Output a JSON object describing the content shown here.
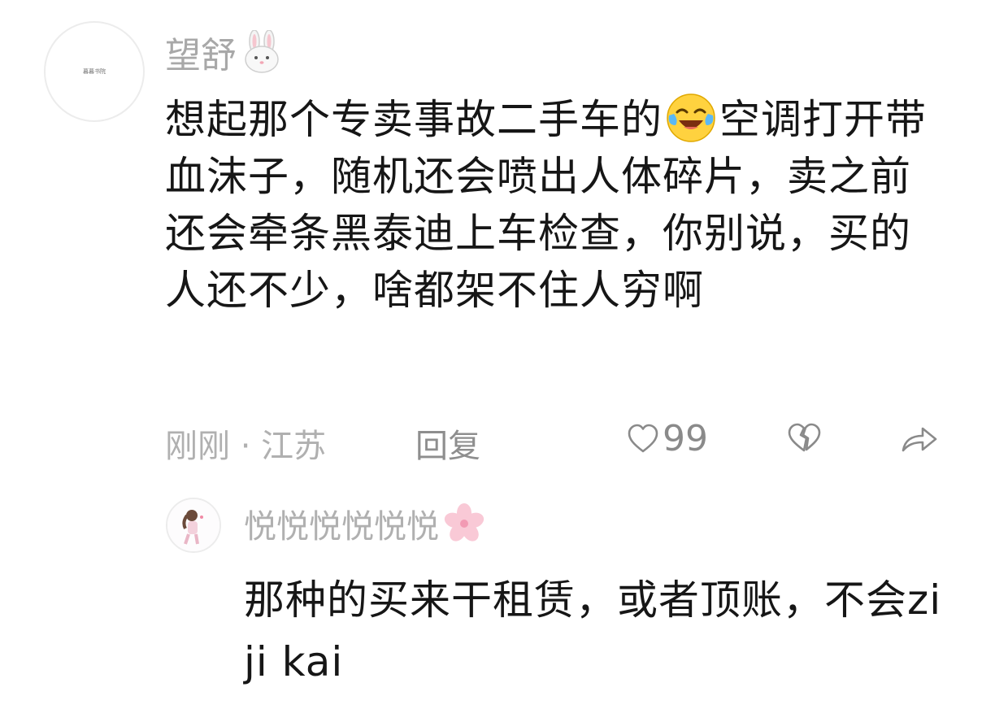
{
  "comment": {
    "avatar_text": "暮暮书院",
    "username": "望舒",
    "username_emoji": "rabbit-face-icon",
    "content_before": "想起那个专卖事故二手车的",
    "content_emoji": "laughing-tears-emoji",
    "content_after": "空调打开带血沫子，随机还会喷出人体碎片，卖之前还会牵条黑泰迪上车检查，你别说，买的人还不少，啥都架不住人穷啊",
    "time": "刚刚",
    "separator": "·",
    "location": "江苏",
    "reply_label": "回复",
    "like_count": "99"
  },
  "reply": {
    "username": "悦悦悦悦悦悦",
    "username_emoji": "cherry-blossom-icon",
    "content": "那种的买来干租赁，或者顶账，不会zi ji kai"
  },
  "colors": {
    "muted_text": "#b0b0b0",
    "body_text": "#161616",
    "icon": "#8a8a8a"
  }
}
